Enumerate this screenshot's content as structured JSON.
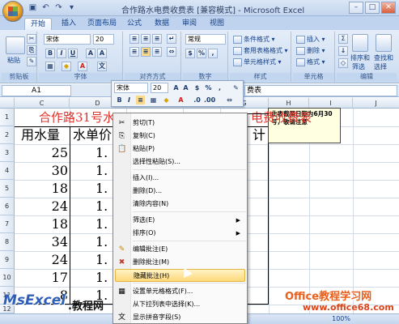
{
  "window": {
    "title": "合作路水电费收费表 [兼容模式] - Microsoft Excel"
  },
  "tabs": [
    "开始",
    "插入",
    "页面布局",
    "公式",
    "数据",
    "审阅",
    "视图"
  ],
  "ribbon": {
    "clipboard": {
      "label": "剪贴板",
      "paste": "粘贴"
    },
    "font": {
      "label": "字体",
      "name": "宋体",
      "size": "20"
    },
    "alignment": {
      "label": "对齐方式"
    },
    "number": {
      "label": "数字",
      "format": "常规"
    },
    "styles": {
      "label": "样式",
      "conditional": "条件格式",
      "table": "套用表格格式",
      "cell": "单元格样式"
    },
    "cells": {
      "label": "单元格",
      "insert": "插入",
      "delete": "删除",
      "format": "格式"
    },
    "editing": {
      "label": "编辑",
      "sort": "排序和",
      "filter": "筛选",
      "find": "查找和",
      "select": "选择"
    }
  },
  "formula_bar": {
    "name_box": "A1",
    "fx": "fx",
    "content_visible": "费表"
  },
  "columns": [
    "C",
    "D",
    "E",
    "F",
    "G",
    "H",
    "I",
    "J"
  ],
  "rows": [
    "1",
    "2",
    "3",
    "4",
    "5",
    "6",
    "7",
    "8",
    "9",
    "10",
    "11",
    "12"
  ],
  "sheet": {
    "title_fragment": "合作路31号",
    "title_fragment2": "水",
    "title_fragment3": "电费收费表",
    "header_c": "用水量",
    "header_d": "水单价",
    "header_h_tail": "计",
    "water_usage": [
      "25",
      "30",
      "18",
      "24",
      "18",
      "34",
      "24",
      "17",
      "8"
    ],
    "unit_price": [
      "1.",
      "1.",
      "1.",
      "1.",
      "1.",
      "1.",
      "1.",
      "1.",
      "1."
    ]
  },
  "comment": {
    "text": "此表截至日期为6月30号，敬请注意"
  },
  "mini_toolbar": {
    "font": "宋体",
    "size": "20"
  },
  "context_menu": {
    "items": [
      {
        "label": "剪切(T)",
        "icon": "scissors-icon"
      },
      {
        "label": "复制(C)",
        "icon": "copy-icon"
      },
      {
        "label": "粘贴(P)",
        "icon": "paste-icon"
      },
      {
        "label": "选择性粘贴(S)...",
        "icon": ""
      },
      {
        "label": "插入(I)...",
        "icon": ""
      },
      {
        "label": "删除(D)...",
        "icon": ""
      },
      {
        "label": "清除内容(N)",
        "icon": ""
      },
      {
        "label": "筛选(E)",
        "icon": "",
        "submenu": true
      },
      {
        "label": "排序(O)",
        "icon": "",
        "submenu": true
      },
      {
        "label": "编辑批注(E)",
        "icon": "edit-comment-icon"
      },
      {
        "label": "删除批注(M)",
        "icon": "delete-comment-icon"
      },
      {
        "label": "隐藏批注(H)",
        "icon": "",
        "highlighted": true
      },
      {
        "label": "设置单元格格式(F)...",
        "icon": "format-cells-icon"
      },
      {
        "label": "从下拉列表中选择(K)...",
        "icon": ""
      },
      {
        "label": "显示拼音字段(S)",
        "icon": "phonetic-icon"
      },
      {
        "label": "命名单元格区域(R)...",
        "icon": ""
      }
    ]
  },
  "status": {
    "zoom": "100%"
  },
  "watermarks": {
    "left_a": "MsExcel",
    "left_b": ".教程网",
    "right_a": "Office教程学习网",
    "right_b": "www.office68.com"
  },
  "colors": {
    "ribbon": "#d3e1f3",
    "highlight": "#fdd878",
    "title_red": "#e0322a",
    "comment_bg": "#ffffe1"
  }
}
